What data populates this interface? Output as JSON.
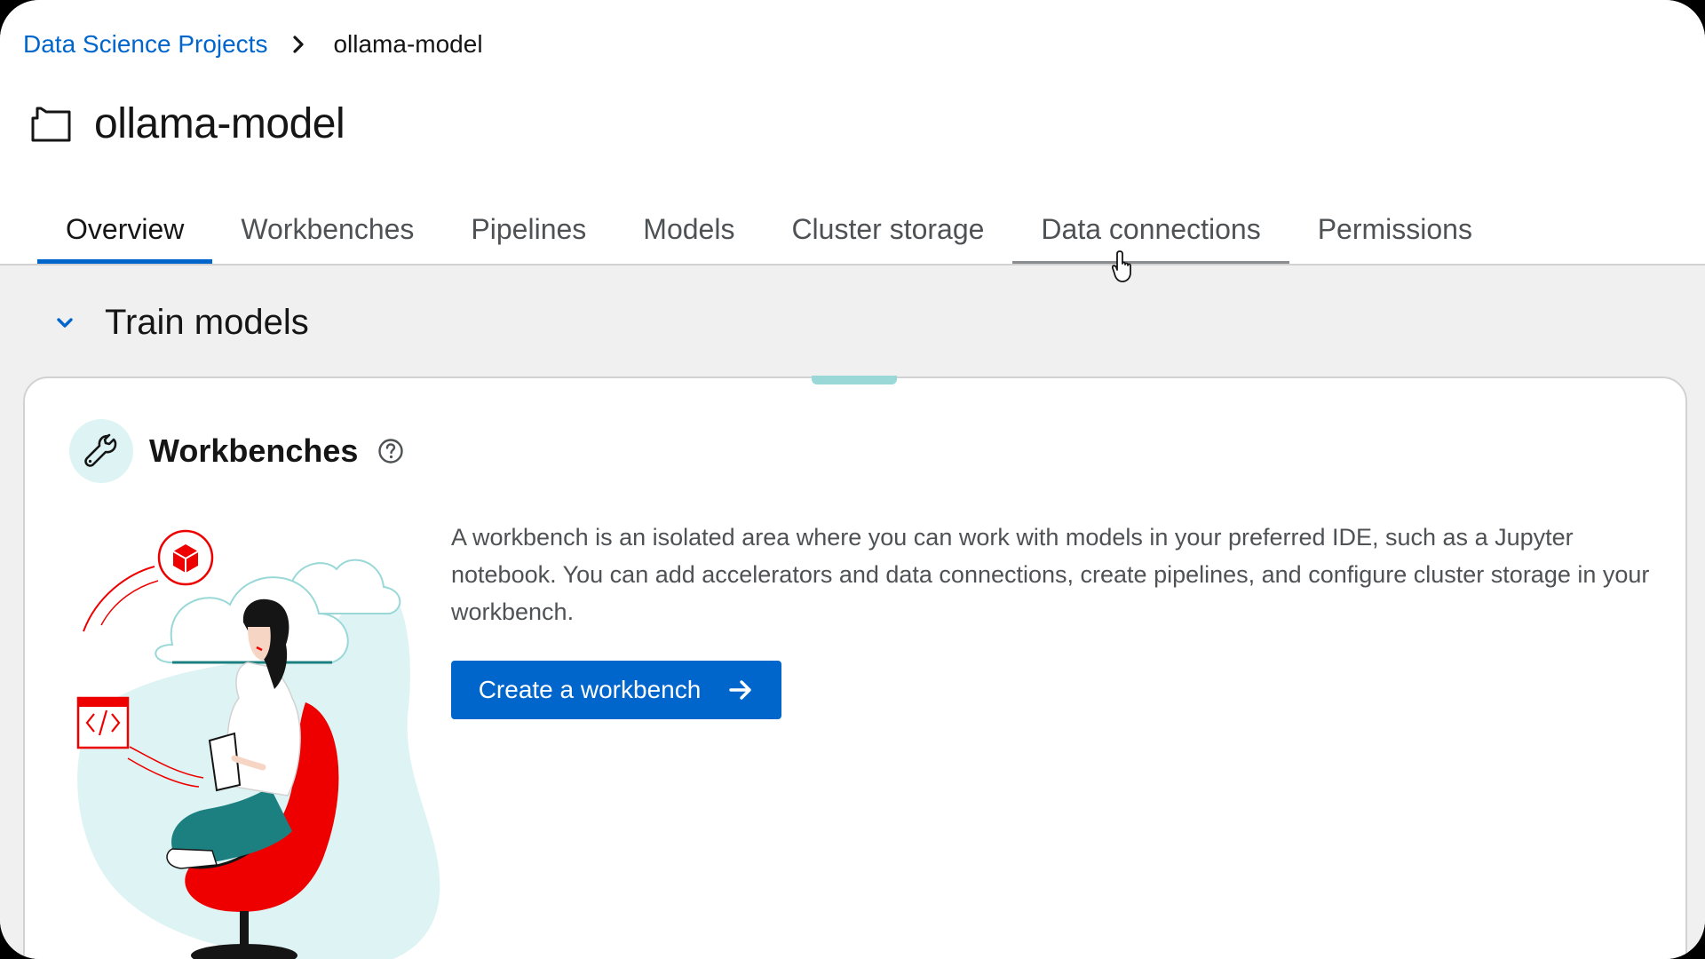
{
  "breadcrumb": {
    "parent": "Data Science Projects",
    "current": "ollama-model"
  },
  "page": {
    "title": "ollama-model"
  },
  "tabs": [
    {
      "label": "Overview",
      "active": true
    },
    {
      "label": "Workbenches",
      "active": false
    },
    {
      "label": "Pipelines",
      "active": false
    },
    {
      "label": "Models",
      "active": false
    },
    {
      "label": "Cluster storage",
      "active": false
    },
    {
      "label": "Data connections",
      "active": false,
      "hovered": true
    },
    {
      "label": "Permissions",
      "active": false
    }
  ],
  "section": {
    "title": "Train models",
    "expanded": true
  },
  "card": {
    "title": "Workbenches",
    "description": "A workbench is an isolated area where you can work with models in your preferred IDE, such as a Jupyter notebook. You can add accelerators and data connections, create pipelines, and configure cluster storage in your workbench.",
    "button_label": "Create a workbench"
  },
  "icons": {
    "project": "project-folder-icon",
    "breadcrumb_separator": "chevron-right-icon",
    "section_toggle": "chevron-down-icon",
    "card": "wrench-icon",
    "help": "help-circle-icon",
    "button": "arrow-right-icon",
    "cursor": "pointer-hand-icon"
  },
  "colors": {
    "link": "#0066cc",
    "primary_button": "#0066cc",
    "active_tab_underline": "#0066cc",
    "hover_tab_underline": "#8a8d90",
    "icon_bg": "#def3f3",
    "page_bg": "#f0f0f0",
    "illustration_red": "#ee0000",
    "illustration_teal": "#1d8080"
  }
}
